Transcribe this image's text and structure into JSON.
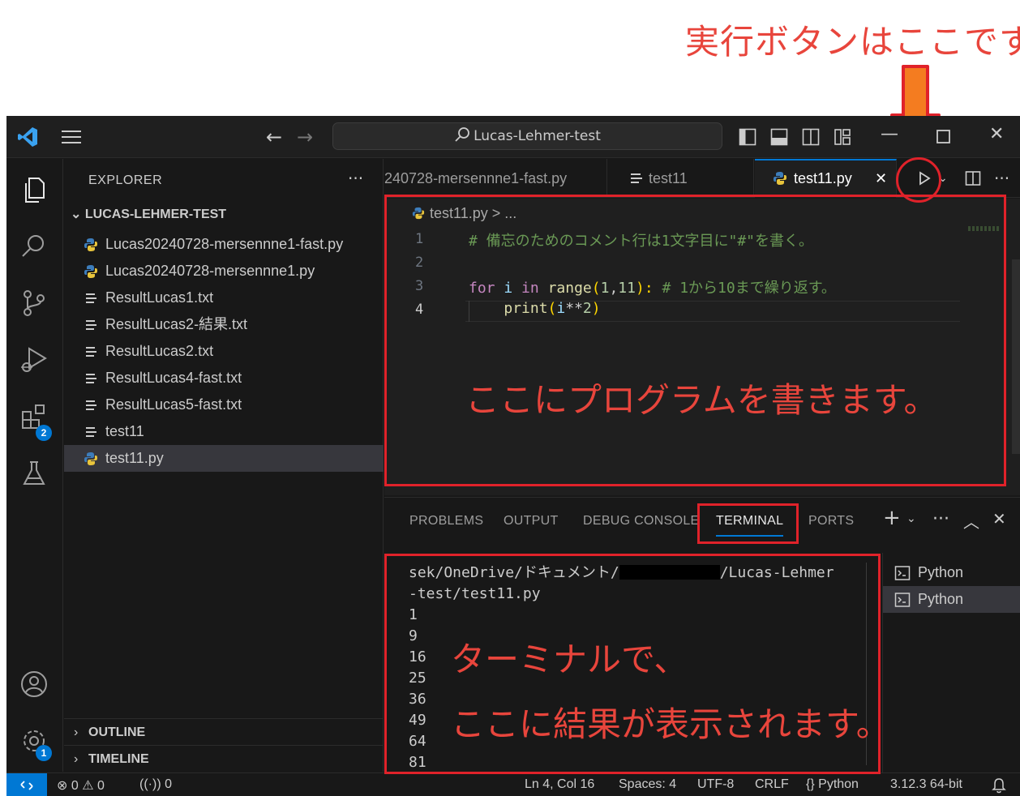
{
  "annotations": {
    "run_button": "実行ボタンはここです。",
    "editor": "ここにプログラムを書きます。",
    "terminal_line1": "ターミナルで、",
    "terminal_line2": "ここに結果が表示されます。"
  },
  "titlebar": {
    "search_text": "Lucas-Lehmer-test"
  },
  "activity_bar": {
    "extensions_badge": "2",
    "settings_badge": "1"
  },
  "sidebar": {
    "title": "EXPLORER",
    "more": "···",
    "root_folder": "LUCAS-LEHMER-TEST",
    "files": [
      {
        "name": "Lucas20240728-mersennne1-fast.py",
        "type": "python"
      },
      {
        "name": "Lucas20240728-mersennne1.py",
        "type": "python"
      },
      {
        "name": "ResultLucas1.txt",
        "type": "text"
      },
      {
        "name": "ResultLucas2-結果.txt",
        "type": "text"
      },
      {
        "name": "ResultLucas2.txt",
        "type": "text"
      },
      {
        "name": "ResultLucas4-fast.txt",
        "type": "text"
      },
      {
        "name": "ResultLucas5-fast.txt",
        "type": "text"
      },
      {
        "name": "test11",
        "type": "text"
      },
      {
        "name": "test11.py",
        "type": "python",
        "active": true
      }
    ],
    "outline": "OUTLINE",
    "timeline": "TIMELINE"
  },
  "tabs": [
    {
      "label": "240728-mersennne1-fast.py"
    },
    {
      "label": "test11"
    },
    {
      "label": "test11.py",
      "active": true
    }
  ],
  "editor": {
    "breadcrumb": "test11.py > ...",
    "line_numbers": [
      "1",
      "2",
      "3",
      "4"
    ],
    "line1_comment": "# 備忘のためのコメント行は1文字目に\"#\"を書く。",
    "line3": {
      "kw_for": "for",
      "var_i": "i",
      "kw_in": "in",
      "fn_range": "range",
      "open": "(",
      "n1": "1",
      "comma": ",",
      "n2": "11",
      "close": "):",
      "comment": "# 1から10まで繰り返す。"
    },
    "line4": {
      "fn_print": "print",
      "open": "(",
      "var_i": "i",
      "op": "**",
      "num": "2",
      "close": ")"
    }
  },
  "panel": {
    "tabs": [
      "PROBLEMS",
      "OUTPUT",
      "DEBUG CONSOLE",
      "TERMINAL",
      "PORTS"
    ],
    "active_tab": "TERMINAL",
    "terminal_path_start": "sek/OneDrive/ドキュメント/",
    "terminal_path_end": "/Lucas-Lehmer",
    "terminal_path_line2": "-test/test11.py",
    "output": [
      "1",
      "9",
      "16",
      "25",
      "36",
      "49",
      "64",
      "81"
    ],
    "terminals": [
      {
        "label": "Python"
      },
      {
        "label": "Python",
        "active": true
      }
    ]
  },
  "statusbar": {
    "errors": "0",
    "warnings": "0",
    "ports": "0",
    "position": "Ln 4, Col 16",
    "spaces": "Spaces: 4",
    "encoding": "UTF-8",
    "eol": "CRLF",
    "language": "Python",
    "interpreter": "3.12.3 64-bit"
  },
  "colors": {
    "annotation_red": "#e8453c",
    "arrow_orange": "#f47c20",
    "accent_blue": "#0078d4"
  }
}
